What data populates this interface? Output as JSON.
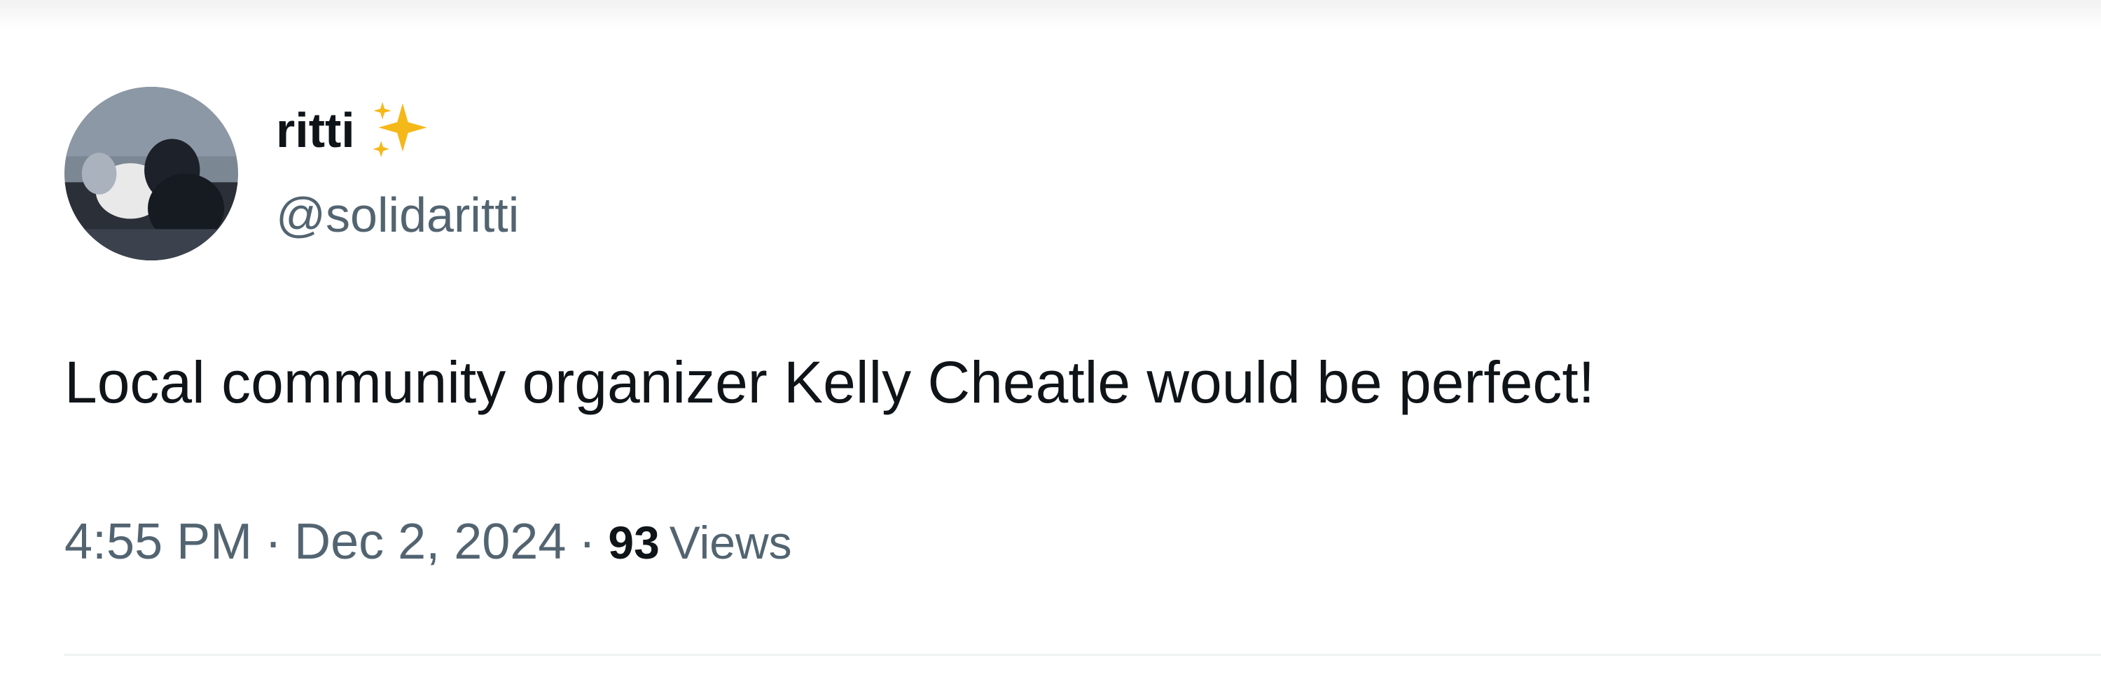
{
  "tweet": {
    "author": {
      "display_name": "ritti",
      "name_emoji_icon": "sparkles-icon",
      "handle": "@solidaritti",
      "avatar": "avatar-photo"
    },
    "text": "Local community organizer Kelly Cheatle would be perfect!",
    "meta": {
      "time": "4:55 PM",
      "separator": "·",
      "date": "Dec 2, 2024",
      "views_count": "93",
      "views_label": "Views"
    }
  },
  "colors": {
    "primary_text": "#0f1419",
    "secondary_text": "#536471",
    "divider": "#eff3f4",
    "sparkle": "#f5b819"
  }
}
